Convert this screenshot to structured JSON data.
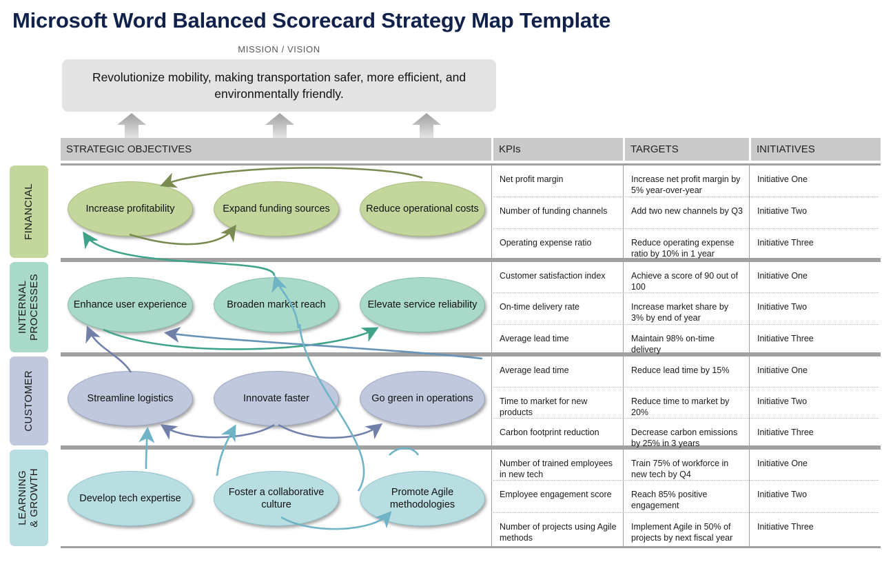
{
  "page": {
    "title": "Microsoft Word Balanced Scorecard Strategy Map Template"
  },
  "mission": {
    "label": "MISSION / VISION",
    "text": "Revolutionize mobility, making transportation safer, more efficient, and environmentally friendly."
  },
  "table_headers": {
    "strategic_objectives": "STRATEGIC OBJECTIVES",
    "kpis": "KPIs",
    "targets": "TARGETS",
    "initiatives": "INITIATIVES"
  },
  "colors": {
    "financial": "#c3d69b",
    "internal_processes": "#a9d9c8",
    "customer": "#bfc8dd",
    "learning_growth": "#b8dee2",
    "header_band": "#c9c9c9",
    "mission_box": "#e3e3e3",
    "title": "#10214b",
    "band_border": "#a0a0a0",
    "arrow_financial": "#7a8b4f",
    "arrow_internal": "#3fa38a",
    "arrow_customer": "#7180a8",
    "arrow_learning": "#6fb3c6"
  },
  "perspectives": [
    {
      "id": "financial",
      "label": "FINANCIAL",
      "color": "#c3d69b",
      "objectives": [
        "Increase profitability",
        "Expand funding sources",
        "Reduce operational costs"
      ],
      "rows": [
        {
          "kpi": "Net profit margin",
          "target": "Increase net profit margin by 5% year-over-year",
          "initiative": "Initiative One"
        },
        {
          "kpi": "Number of funding channels",
          "target": "Add two new channels by Q3",
          "initiative": "Initiative Two"
        },
        {
          "kpi": "Operating expense ratio",
          "target": "Reduce operating expense ratio by 10% in 1 year",
          "initiative": "Initiative Three"
        }
      ]
    },
    {
      "id": "internal_processes",
      "label": "INTERNAL\nPROCESSES",
      "color": "#a9d9c8",
      "objectives": [
        "Enhance user experience",
        "Broaden market reach",
        "Elevate service reliability"
      ],
      "rows": [
        {
          "kpi": "Customer satisfaction index",
          "target": "Achieve a score of 90 out of 100",
          "initiative": "Initiative One"
        },
        {
          "kpi": "On-time delivery rate",
          "target": "Increase market share by 3% by end of year",
          "initiative": "Initiative Two"
        },
        {
          "kpi": "Average lead time",
          "target": "Maintain 98% on-time delivery",
          "initiative": "Initiative Three"
        }
      ]
    },
    {
      "id": "customer",
      "label": "CUSTOMER",
      "color": "#bfc8dd",
      "objectives": [
        "Streamline logistics",
        "Innovate  faster",
        "Go green in operations"
      ],
      "rows": [
        {
          "kpi": "Average lead time",
          "target": "Reduce lead time by 15%",
          "initiative": "Initiative One"
        },
        {
          "kpi": "Time to market for new products",
          "target": "Reduce time to market by 20%",
          "initiative": "Initiative Two"
        },
        {
          "kpi": "Carbon footprint reduction",
          "target": "Decrease carbon emissions by 25% in 3 years",
          "initiative": "Initiative Three"
        }
      ]
    },
    {
      "id": "learning_growth",
      "label": "LEARNING\n& GROWTH",
      "color": "#b8dee2",
      "objectives": [
        "Develop tech expertise",
        "Foster a collaborative culture",
        "Promote Agile methodologies"
      ],
      "rows": [
        {
          "kpi": "Number of trained employees in new tech",
          "target": "Train 75% of workforce in new tech by Q4",
          "initiative": "Initiative One"
        },
        {
          "kpi": "Employee engagement score",
          "target": "Reach 85% positive engagement",
          "initiative": "Initiative Two"
        },
        {
          "kpi": "Number of projects using Agile methods",
          "target": "Implement Agile in 50% of projects by next fiscal year",
          "initiative": "Initiative Three"
        }
      ]
    }
  ]
}
